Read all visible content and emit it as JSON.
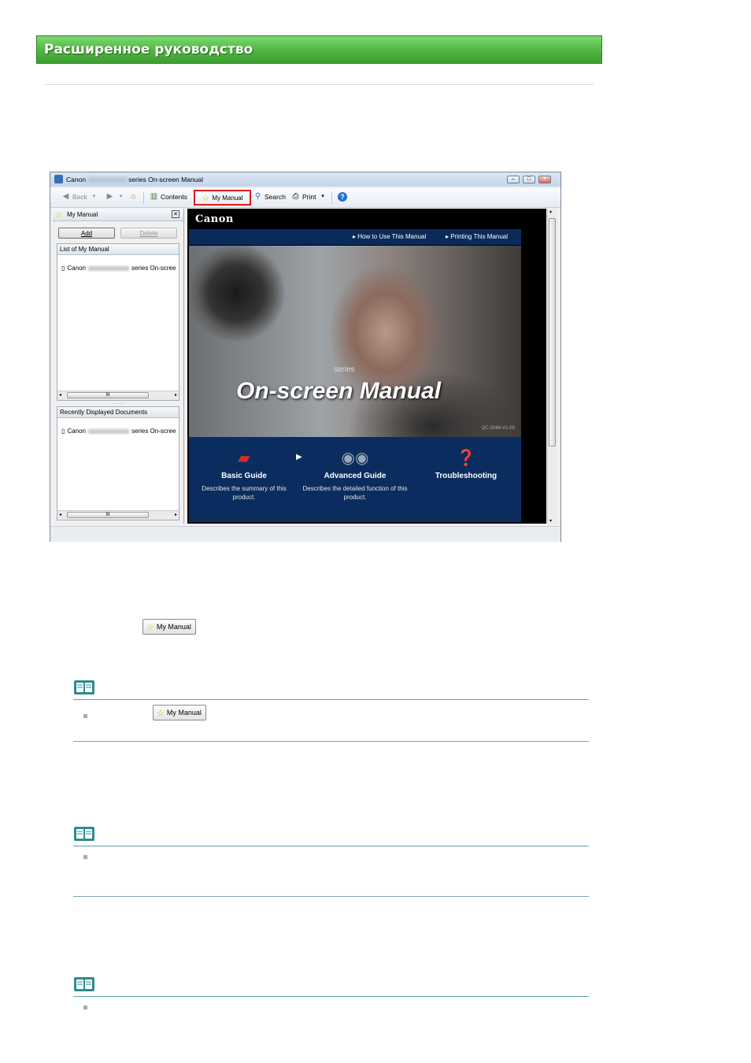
{
  "header": {
    "title": "Расширенное руководство"
  },
  "window": {
    "title_prefix": "Canon",
    "title_suffix": "series On-screen Manual",
    "controls": {
      "minimize": "–",
      "maximize": "□",
      "close": "✕"
    }
  },
  "toolbar": {
    "back": "Back",
    "contents": "Contents",
    "my_manual": "My Manual",
    "search": "Search",
    "print": "Print",
    "help": "?"
  },
  "left_pane": {
    "title": "My Manual",
    "close": "✕",
    "add": "Add",
    "delete": "Delete",
    "list_header": "List of My Manual",
    "list_items": [
      {
        "prefix": "Canon",
        "suffix": "series On-scree"
      }
    ],
    "recent_header": "Recently Displayed Documents",
    "recent_items": [
      {
        "prefix": "Canon",
        "suffix": "series On-scree"
      }
    ],
    "scroll_thumb": "III"
  },
  "content": {
    "logo": "Canon",
    "nav_links": [
      "How to Use This Manual",
      "Printing This Manual"
    ],
    "series": "series",
    "headline": "On-screen Manual",
    "code": "QC-3046-V1-00",
    "guides": [
      {
        "title": "Basic Guide",
        "desc": "Describes the summary of this product.",
        "icon": "book-icon"
      },
      {
        "title": "Advanced Guide",
        "desc": "Describes the detailed function of this product.",
        "icon": "binoculars-icon"
      },
      {
        "title": "Troubleshooting",
        "desc": "",
        "icon": "help-icon"
      }
    ]
  },
  "inline_buttons": {
    "my_manual_1": "My Manual",
    "my_manual_2": "My Manual"
  },
  "colors": {
    "banner": "#4fb540",
    "note_rule": "#5aa3a8",
    "nav_blue": "#0a2a5a",
    "highlight": "#e21b1b"
  }
}
